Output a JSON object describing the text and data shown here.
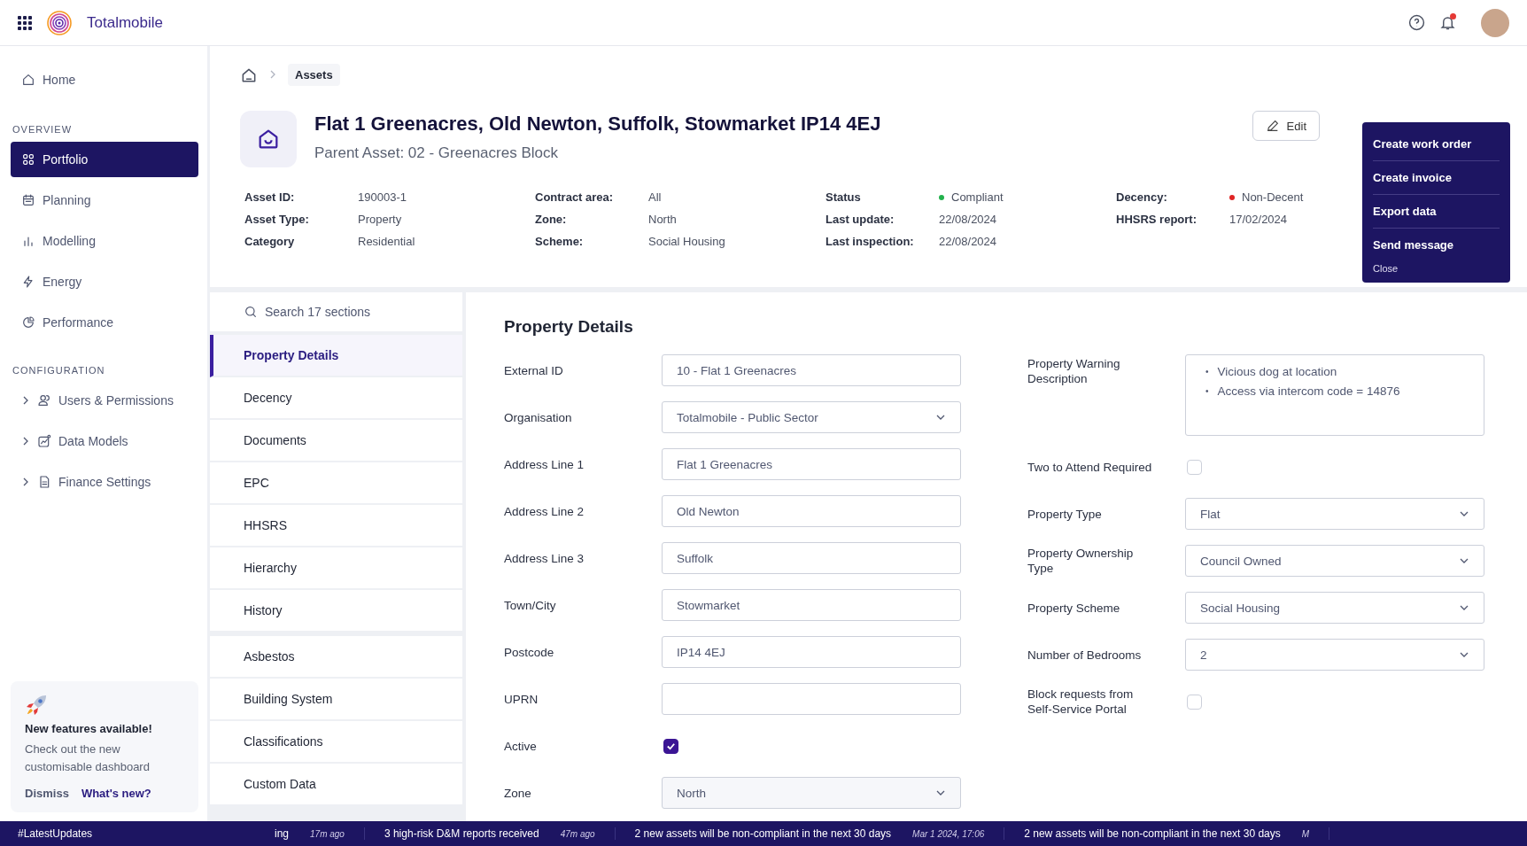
{
  "app": {
    "name": "Totalmobile"
  },
  "sidebar": {
    "home": {
      "label": "Home"
    },
    "sections": [
      {
        "title": "OVERVIEW",
        "items": [
          {
            "kind": "link",
            "label": "Portfolio",
            "selected": true
          },
          {
            "kind": "link",
            "label": "Planning",
            "selected": false
          },
          {
            "kind": "link",
            "label": "Modelling",
            "selected": false
          },
          {
            "kind": "link",
            "label": "Energy",
            "selected": false
          },
          {
            "kind": "link",
            "label": "Performance",
            "selected": false
          }
        ]
      },
      {
        "title": "CONFIGURATION",
        "items": [
          {
            "kind": "group",
            "label": "Users & Permissions",
            "selected": false
          },
          {
            "kind": "group",
            "label": "Data Models",
            "selected": false
          },
          {
            "kind": "group",
            "label": "Finance Settings",
            "selected": false
          }
        ]
      }
    ],
    "promo": {
      "title": "New features available!",
      "text": "Check out the new customisable dashboard",
      "dismiss": "Dismiss",
      "link": "What's new?"
    }
  },
  "breadcrumb": [
    "Assets"
  ],
  "asset": {
    "title": "Flat 1 Greenacres, Old Newton, Suffolk, Stowmarket IP14 4EJ",
    "subtitle": "Parent Asset: 02 - Greenacres Block",
    "info": [
      [
        {
          "label": "Asset ID:",
          "value": "190003-1"
        },
        {
          "label": "Asset Type:",
          "value": "Property"
        },
        {
          "label": "Category",
          "value": "Residential"
        }
      ],
      [
        {
          "label": "Contract area:",
          "value": "All"
        },
        {
          "label": "Zone:",
          "value": "North"
        },
        {
          "label": "Scheme:",
          "value": "Social Housing"
        }
      ],
      [
        {
          "label": "Status",
          "value": "Compliant",
          "color": "#22b14c"
        },
        {
          "label": "Last update:",
          "value": "22/08/2024"
        },
        {
          "label": "Last inspection:",
          "value": "22/08/2024"
        }
      ],
      [
        {
          "label": "Decency:",
          "value": "Non-Decent",
          "color": "#e02424"
        },
        {
          "label": "HHSRS report:",
          "value": "17/02/2024"
        }
      ]
    ]
  },
  "edit_button": "Edit",
  "actions_menu": {
    "items": [
      "Create work order",
      "Create invoice",
      "Export data",
      "Send message"
    ],
    "close": "Close"
  },
  "sections_nav": {
    "placeholder": "Search 17 sections",
    "groups": [
      [
        {
          "label": "Property Details",
          "selected": true
        },
        {
          "label": "Decency",
          "selected": false
        },
        {
          "label": "Documents",
          "selected": false
        },
        {
          "label": "EPC",
          "selected": false
        },
        {
          "label": "HHSRS",
          "selected": false
        },
        {
          "label": "Hierarchy",
          "selected": false
        },
        {
          "label": "History",
          "selected": false
        }
      ],
      [
        {
          "label": "Asbestos",
          "selected": false
        },
        {
          "label": "Building System",
          "selected": false
        },
        {
          "label": "Classifications",
          "selected": false
        },
        {
          "label": "Custom Data",
          "selected": false
        }
      ]
    ]
  },
  "form": {
    "title": "Property Details",
    "left": [
      {
        "kind": "text",
        "label": "External ID",
        "value": "10 - Flat 1 Greenacres"
      },
      {
        "kind": "select",
        "label": "Organisation",
        "value": "Totalmobile - Public Sector"
      },
      {
        "kind": "text",
        "label": "Address Line 1",
        "value": "Flat 1 Greenacres"
      },
      {
        "kind": "text",
        "label": "Address Line 2",
        "value": "Old Newton"
      },
      {
        "kind": "text",
        "label": "Address Line 3",
        "value": "Suffolk"
      },
      {
        "kind": "text",
        "label": "Town/City",
        "value": "Stowmarket"
      },
      {
        "kind": "text",
        "label": "Postcode",
        "value": "IP14 4EJ"
      },
      {
        "kind": "text",
        "label": "UPRN"
      },
      {
        "kind": "checkbox",
        "label": "Active",
        "checked": true
      },
      {
        "kind": "select",
        "label": "Zone",
        "value": "North",
        "disabled": true
      }
    ],
    "right": [
      {
        "kind": "list",
        "label": "Property Warning Description",
        "marker": "•",
        "items": [
          "Vicious dog at location",
          "Access via intercom code = 14876"
        ]
      },
      {
        "kind": "checkbox",
        "label": "Two to Attend Required",
        "checked": false
      },
      {
        "kind": "select",
        "label": "Property Type",
        "value": "Flat"
      },
      {
        "kind": "select",
        "label": "Property Ownership Type",
        "value": "Council Owned"
      },
      {
        "kind": "select",
        "label": "Property Scheme",
        "value": "Social Housing"
      },
      {
        "kind": "select",
        "label": "Number of Bedrooms",
        "value": "2"
      },
      {
        "kind": "checkbox",
        "label": "Block requests from Self-Service Portal",
        "checked": false
      }
    ]
  },
  "ticker": {
    "tag": "#LatestUpdates",
    "items": [
      {
        "text": "ing",
        "time": "17m ago"
      },
      {
        "text": "3 high-risk D&M reports received",
        "time": "47m ago"
      },
      {
        "text": "2 new assets will be non-compliant in the next 30 days",
        "time": "Mar 1 2024, 17:06"
      },
      {
        "text": "2 new assets will be non-compliant in the next 30 days",
        "time": "M"
      }
    ]
  }
}
